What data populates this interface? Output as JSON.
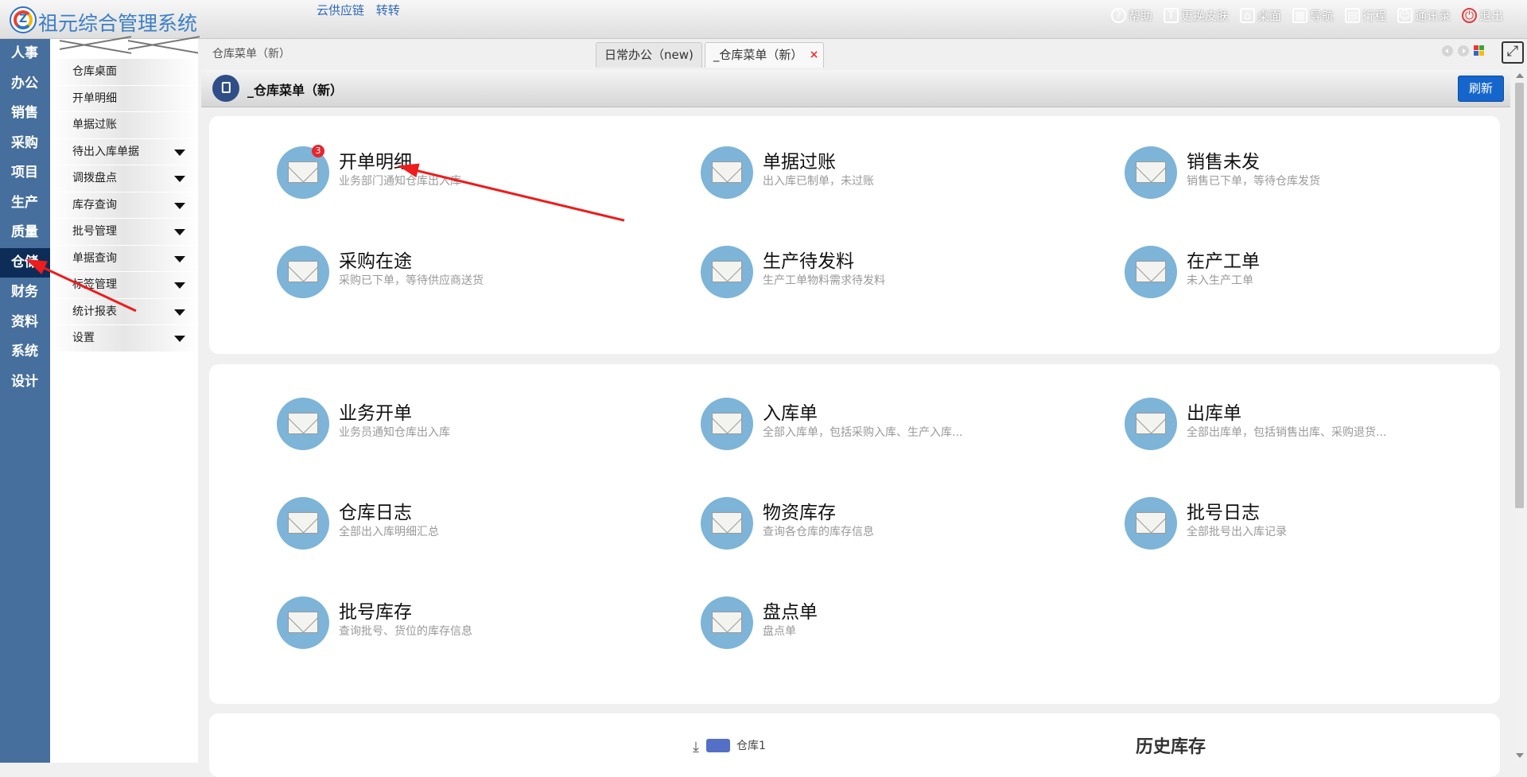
{
  "app": {
    "title": "祖元综合管理系统"
  },
  "quick_links": [
    "云供应链",
    "转转"
  ],
  "top_actions": [
    {
      "label": "帮助",
      "icon": "help-icon"
    },
    {
      "label": "更换皮肤",
      "icon": "shirt-icon"
    },
    {
      "label": "桌面",
      "icon": "home-icon"
    },
    {
      "label": "导航",
      "icon": "grid-icon"
    },
    {
      "label": "行程",
      "icon": "calendar-icon"
    },
    {
      "label": "通讯录",
      "icon": "contacts-icon"
    },
    {
      "label": "退出",
      "icon": "power-icon"
    }
  ],
  "left_nav": [
    "人事",
    "办公",
    "销售",
    "采购",
    "项目",
    "生产",
    "质量",
    "仓储",
    "财务",
    "资料",
    "系统",
    "设计"
  ],
  "left_nav_active": "仓储",
  "menu": {
    "items": [
      {
        "label": "仓库桌面",
        "expandable": false
      },
      {
        "label": "开单明细",
        "expandable": false
      },
      {
        "label": "单据过账",
        "expandable": false
      },
      {
        "label": "待出入库单据",
        "expandable": true
      },
      {
        "label": "调拨盘点",
        "expandable": true
      },
      {
        "label": "库存查询",
        "expandable": true
      },
      {
        "label": "批号管理",
        "expandable": true
      },
      {
        "label": "单据查询",
        "expandable": true
      },
      {
        "label": "标签管理",
        "expandable": true
      },
      {
        "label": "统计报表",
        "expandable": true
      },
      {
        "label": "设置",
        "expandable": true
      }
    ]
  },
  "breadcrumb": "仓库菜单（新）",
  "tabs": [
    {
      "label": "日常办公（new)",
      "active": false
    },
    {
      "label": "_仓库菜单（新）",
      "active": true,
      "close": "×"
    }
  ],
  "page": {
    "title": "_仓库菜单（新）",
    "refresh_label": "刷新",
    "expand_glyph": "⤢"
  },
  "section1": [
    {
      "title": "开单明细",
      "desc": "业务部门通知仓库出入库",
      "badge": "3"
    },
    {
      "title": "单据过账",
      "desc": "出入库已制单，未过账"
    },
    {
      "title": "销售未发",
      "desc": "销售已下单，等待仓库发货"
    },
    {
      "title": "采购在途",
      "desc": "采购已下单，等待供应商送货"
    },
    {
      "title": "生产待发料",
      "desc": "生产工单物料需求待发料"
    },
    {
      "title": "在产工单",
      "desc": "未入生产工单"
    }
  ],
  "section2": [
    {
      "title": "业务开单",
      "desc": "业务员通知仓库出入库"
    },
    {
      "title": "入库单",
      "desc": "全部入库单，包括采购入库、生产入库..."
    },
    {
      "title": "出库单",
      "desc": "全部出库单，包括销售出库、采购退货..."
    },
    {
      "title": "仓库日志",
      "desc": "全部出入库明细汇总"
    },
    {
      "title": "物资库存",
      "desc": "查询各仓库的库存信息"
    },
    {
      "title": "批号日志",
      "desc": "全部批号出入库记录"
    },
    {
      "title": "批号库存",
      "desc": "查询批号、货位的库存信息"
    },
    {
      "title": "盘点单",
      "desc": "盘点单"
    }
  ],
  "section3": {
    "legend": "仓库1",
    "history_title": "历史库存",
    "download_glyph": "⤓"
  },
  "colors": {
    "nav_bg": "#466f9d",
    "nav_active": "#0d2d58",
    "accent": "#1566cc",
    "annotation": "#ee1c1c",
    "badge": "#e5282d"
  }
}
